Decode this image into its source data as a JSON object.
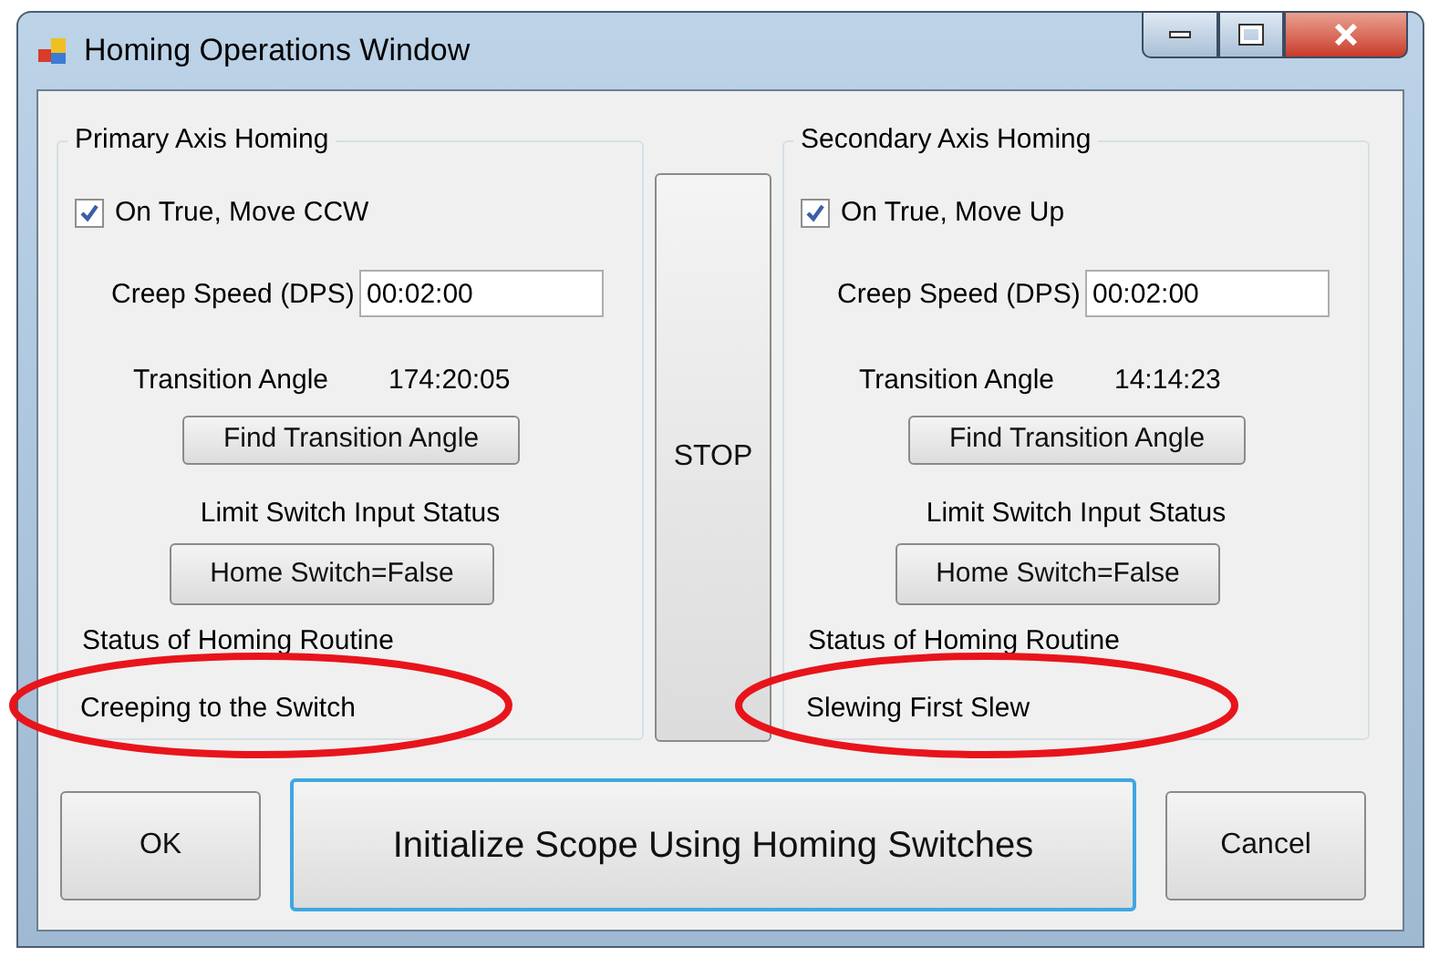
{
  "window": {
    "title": "Homing Operations Window"
  },
  "panels": [
    {
      "title": "Primary Axis Homing",
      "checkbox": {
        "label": "On True, Move CCW",
        "checked": true
      },
      "creep_speed": {
        "label": "Creep Speed (DPS)",
        "value": "00:02:00"
      },
      "transition_angle": {
        "label": "Transition Angle",
        "value": "174:20:05"
      },
      "find_button": "Find Transition Angle",
      "limit_label": "Limit Switch Input Status",
      "switch_button": "Home Switch=False",
      "status_label": "Status of Homing Routine",
      "status_value": "Creeping to the Switch",
      "highlighted": true
    },
    {
      "title": "Secondary Axis Homing",
      "checkbox": {
        "label": "On True, Move Up",
        "checked": true
      },
      "creep_speed": {
        "label": "Creep Speed (DPS)",
        "value": "00:02:00"
      },
      "transition_angle": {
        "label": "Transition Angle",
        "value": "14:14:23"
      },
      "find_button": "Find Transition Angle",
      "limit_label": "Limit Switch Input Status",
      "switch_button": "Home Switch=False",
      "status_label": "Status of Homing Routine",
      "status_value": "Slewing First Slew",
      "highlighted": true
    }
  ],
  "stop_button": "STOP",
  "buttons": [
    {
      "label": "OK",
      "kind": "normal"
    },
    {
      "label": "Initialize Scope Using Homing Switches",
      "kind": "default"
    },
    {
      "label": "Cancel",
      "kind": "normal"
    }
  ]
}
